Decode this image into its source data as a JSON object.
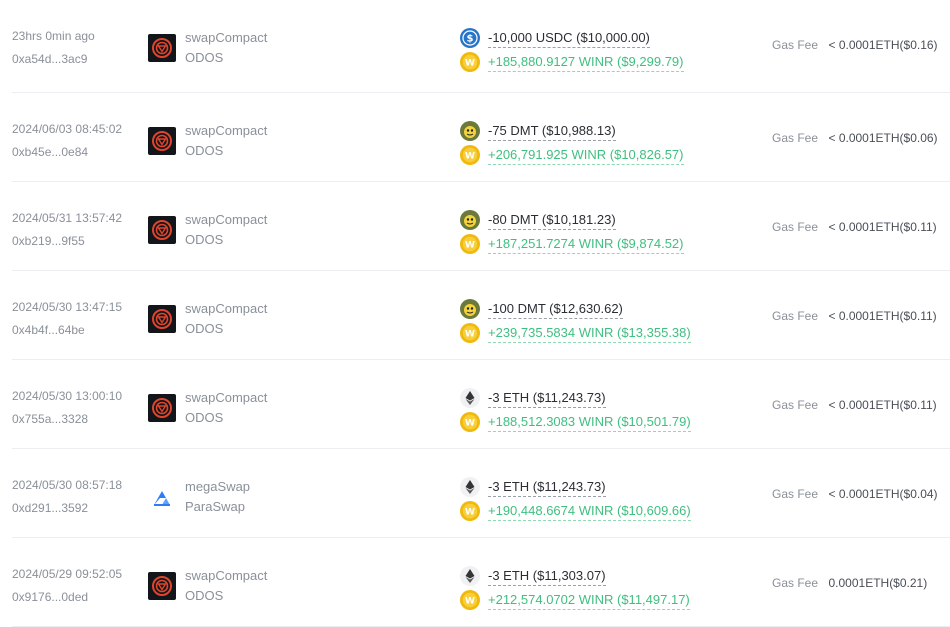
{
  "rows": [
    {
      "time": "23hrs 0min ago",
      "hash": "0xa54d...3ac9",
      "method": "swapCompact",
      "protocol": "ODOS",
      "protocol_icon": "odos-icon",
      "out": {
        "token_icon": "usdc-icon",
        "text": "-10,000 USDC ($10,000.00)"
      },
      "in": {
        "token_icon": "winr-icon",
        "text": "+185,880.9127 WINR ($9,299.79)"
      },
      "gas_label": "Gas Fee",
      "gas_value": "< 0.0001ETH($0.16)"
    },
    {
      "time": "2024/06/03 08:45:02",
      "hash": "0xb45e...0e84",
      "method": "swapCompact",
      "protocol": "ODOS",
      "protocol_icon": "odos-icon",
      "out": {
        "token_icon": "dmt-icon",
        "text": "-75 DMT ($10,988.13)"
      },
      "in": {
        "token_icon": "winr-icon",
        "text": "+206,791.925 WINR ($10,826.57)"
      },
      "gas_label": "Gas Fee",
      "gas_value": "< 0.0001ETH($0.06)"
    },
    {
      "time": "2024/05/31 13:57:42",
      "hash": "0xb219...9f55",
      "method": "swapCompact",
      "protocol": "ODOS",
      "protocol_icon": "odos-icon",
      "out": {
        "token_icon": "dmt-icon",
        "text": "-80 DMT ($10,181.23)"
      },
      "in": {
        "token_icon": "winr-icon",
        "text": "+187,251.7274 WINR ($9,874.52)"
      },
      "gas_label": "Gas Fee",
      "gas_value": "< 0.0001ETH($0.11)"
    },
    {
      "time": "2024/05/30 13:47:15",
      "hash": "0x4b4f...64be",
      "method": "swapCompact",
      "protocol": "ODOS",
      "protocol_icon": "odos-icon",
      "out": {
        "token_icon": "dmt-icon",
        "text": "-100 DMT ($12,630.62)"
      },
      "in": {
        "token_icon": "winr-icon",
        "text": "+239,735.5834 WINR ($13,355.38)"
      },
      "gas_label": "Gas Fee",
      "gas_value": "< 0.0001ETH($0.11)"
    },
    {
      "time": "2024/05/30 13:00:10",
      "hash": "0x755a...3328",
      "method": "swapCompact",
      "protocol": "ODOS",
      "protocol_icon": "odos-icon",
      "out": {
        "token_icon": "eth-icon",
        "text": "-3 ETH ($11,243.73)"
      },
      "in": {
        "token_icon": "winr-icon",
        "text": "+188,512.3083 WINR ($10,501.79)"
      },
      "gas_label": "Gas Fee",
      "gas_value": "< 0.0001ETH($0.11)"
    },
    {
      "time": "2024/05/30 08:57:18",
      "hash": "0xd291...3592",
      "method": "megaSwap",
      "protocol": "ParaSwap",
      "protocol_icon": "paraswap-icon",
      "out": {
        "token_icon": "eth-icon",
        "text": "-3 ETH ($11,243.73)"
      },
      "in": {
        "token_icon": "winr-icon",
        "text": "+190,448.6674 WINR ($10,609.66)"
      },
      "gas_label": "Gas Fee",
      "gas_value": "< 0.0001ETH($0.04)"
    },
    {
      "time": "2024/05/29 09:52:05",
      "hash": "0x9176...0ded",
      "method": "swapCompact",
      "protocol": "ODOS",
      "protocol_icon": "odos-icon",
      "out": {
        "token_icon": "eth-icon",
        "text": "-3 ETH ($11,303.07)"
      },
      "in": {
        "token_icon": "winr-icon",
        "text": "+212,574.0702 WINR ($11,497.17)"
      },
      "gas_label": "Gas Fee",
      "gas_value": "0.0001ETH($0.21)"
    }
  ],
  "colors": {
    "positive": "#3fbf7f",
    "negative": "#2a2e34",
    "muted": "#8a9099",
    "usdc": "#2775ca",
    "winr": "#f0b90b",
    "paraswap": "#2f7df6"
  }
}
